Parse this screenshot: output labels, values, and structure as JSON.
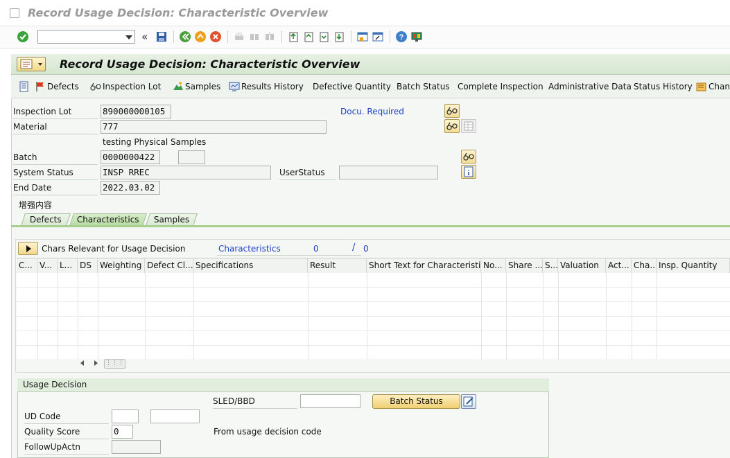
{
  "window": {
    "title": "Record Usage Decision: Characteristic Overview"
  },
  "toolbar": {
    "command_field_value": "",
    "collapse_glyph": "«",
    "icons": [
      "enter-icon",
      "save-icon",
      "back-icon",
      "exit-icon",
      "cancel-icon",
      "print-icon",
      "find-icon",
      "find-next-icon",
      "first-page-icon",
      "previous-page-icon",
      "next-page-icon",
      "last-page-icon",
      "create-session-icon",
      "shortcut-icon",
      "help-icon",
      "customize-layout-icon"
    ]
  },
  "header": {
    "title": "Record Usage Decision: Characteristic Overview"
  },
  "app_toolbar": {
    "items": [
      {
        "label": "Defects"
      },
      {
        "label": "Inspection Lot"
      },
      {
        "label": "Samples"
      },
      {
        "label": "Results History"
      },
      {
        "label": "Defective Quantity"
      },
      {
        "label": "Batch Status"
      },
      {
        "label": "Complete Inspection"
      },
      {
        "label": "Administrative Data"
      },
      {
        "label": "Status History"
      },
      {
        "label": "Chang"
      }
    ]
  },
  "form": {
    "inspection_lot_label": "Inspection Lot",
    "inspection_lot_value": "890000000105",
    "docu_required": "Docu. Required",
    "material_label": "Material",
    "material_value": "777",
    "material_desc": "testing Physical Samples",
    "batch_label": "Batch",
    "batch_value": "0000000422",
    "batch_extra": "",
    "system_status_label": "System Status",
    "system_status_value": "INSP RREC",
    "user_status_label": "UserStatus",
    "user_status_value": "",
    "end_date_label": "End Date",
    "end_date_value": "2022.03.02",
    "enhancement_label": "增强内容"
  },
  "tabs": [
    {
      "label": "Defects",
      "active": false
    },
    {
      "label": "Characteristics",
      "active": true
    },
    {
      "label": "Samples",
      "active": false
    }
  ],
  "characteristics": {
    "relevant_label": "Chars Relevant for Usage Decision",
    "link_label": "Characteristics",
    "count_current": "0",
    "count_sep": "/",
    "count_total": "0",
    "columns": [
      "C...",
      "V...",
      "L...",
      "DS",
      "Weighting",
      "Defect Cl...",
      "Specifications",
      "Result",
      "Short Text for Characteristic",
      "No...",
      "Share ...",
      "S...",
      "Valuation",
      "Act...",
      "Cha...",
      "Insp. Quantity"
    ],
    "rows": []
  },
  "usage_decision": {
    "group_title": "Usage Decision",
    "sled_label": "SLED/BBD",
    "sled_value": "",
    "batch_status_button": "Batch Status",
    "ud_code_label": "UD Code",
    "ud_code_value": "",
    "ud_code_value2": "",
    "quality_score_label": "Quality Score",
    "quality_score_value": "0",
    "from_ud_code": "From usage decision code",
    "followup_label": "FollowUpActn",
    "followup_value": ""
  }
}
